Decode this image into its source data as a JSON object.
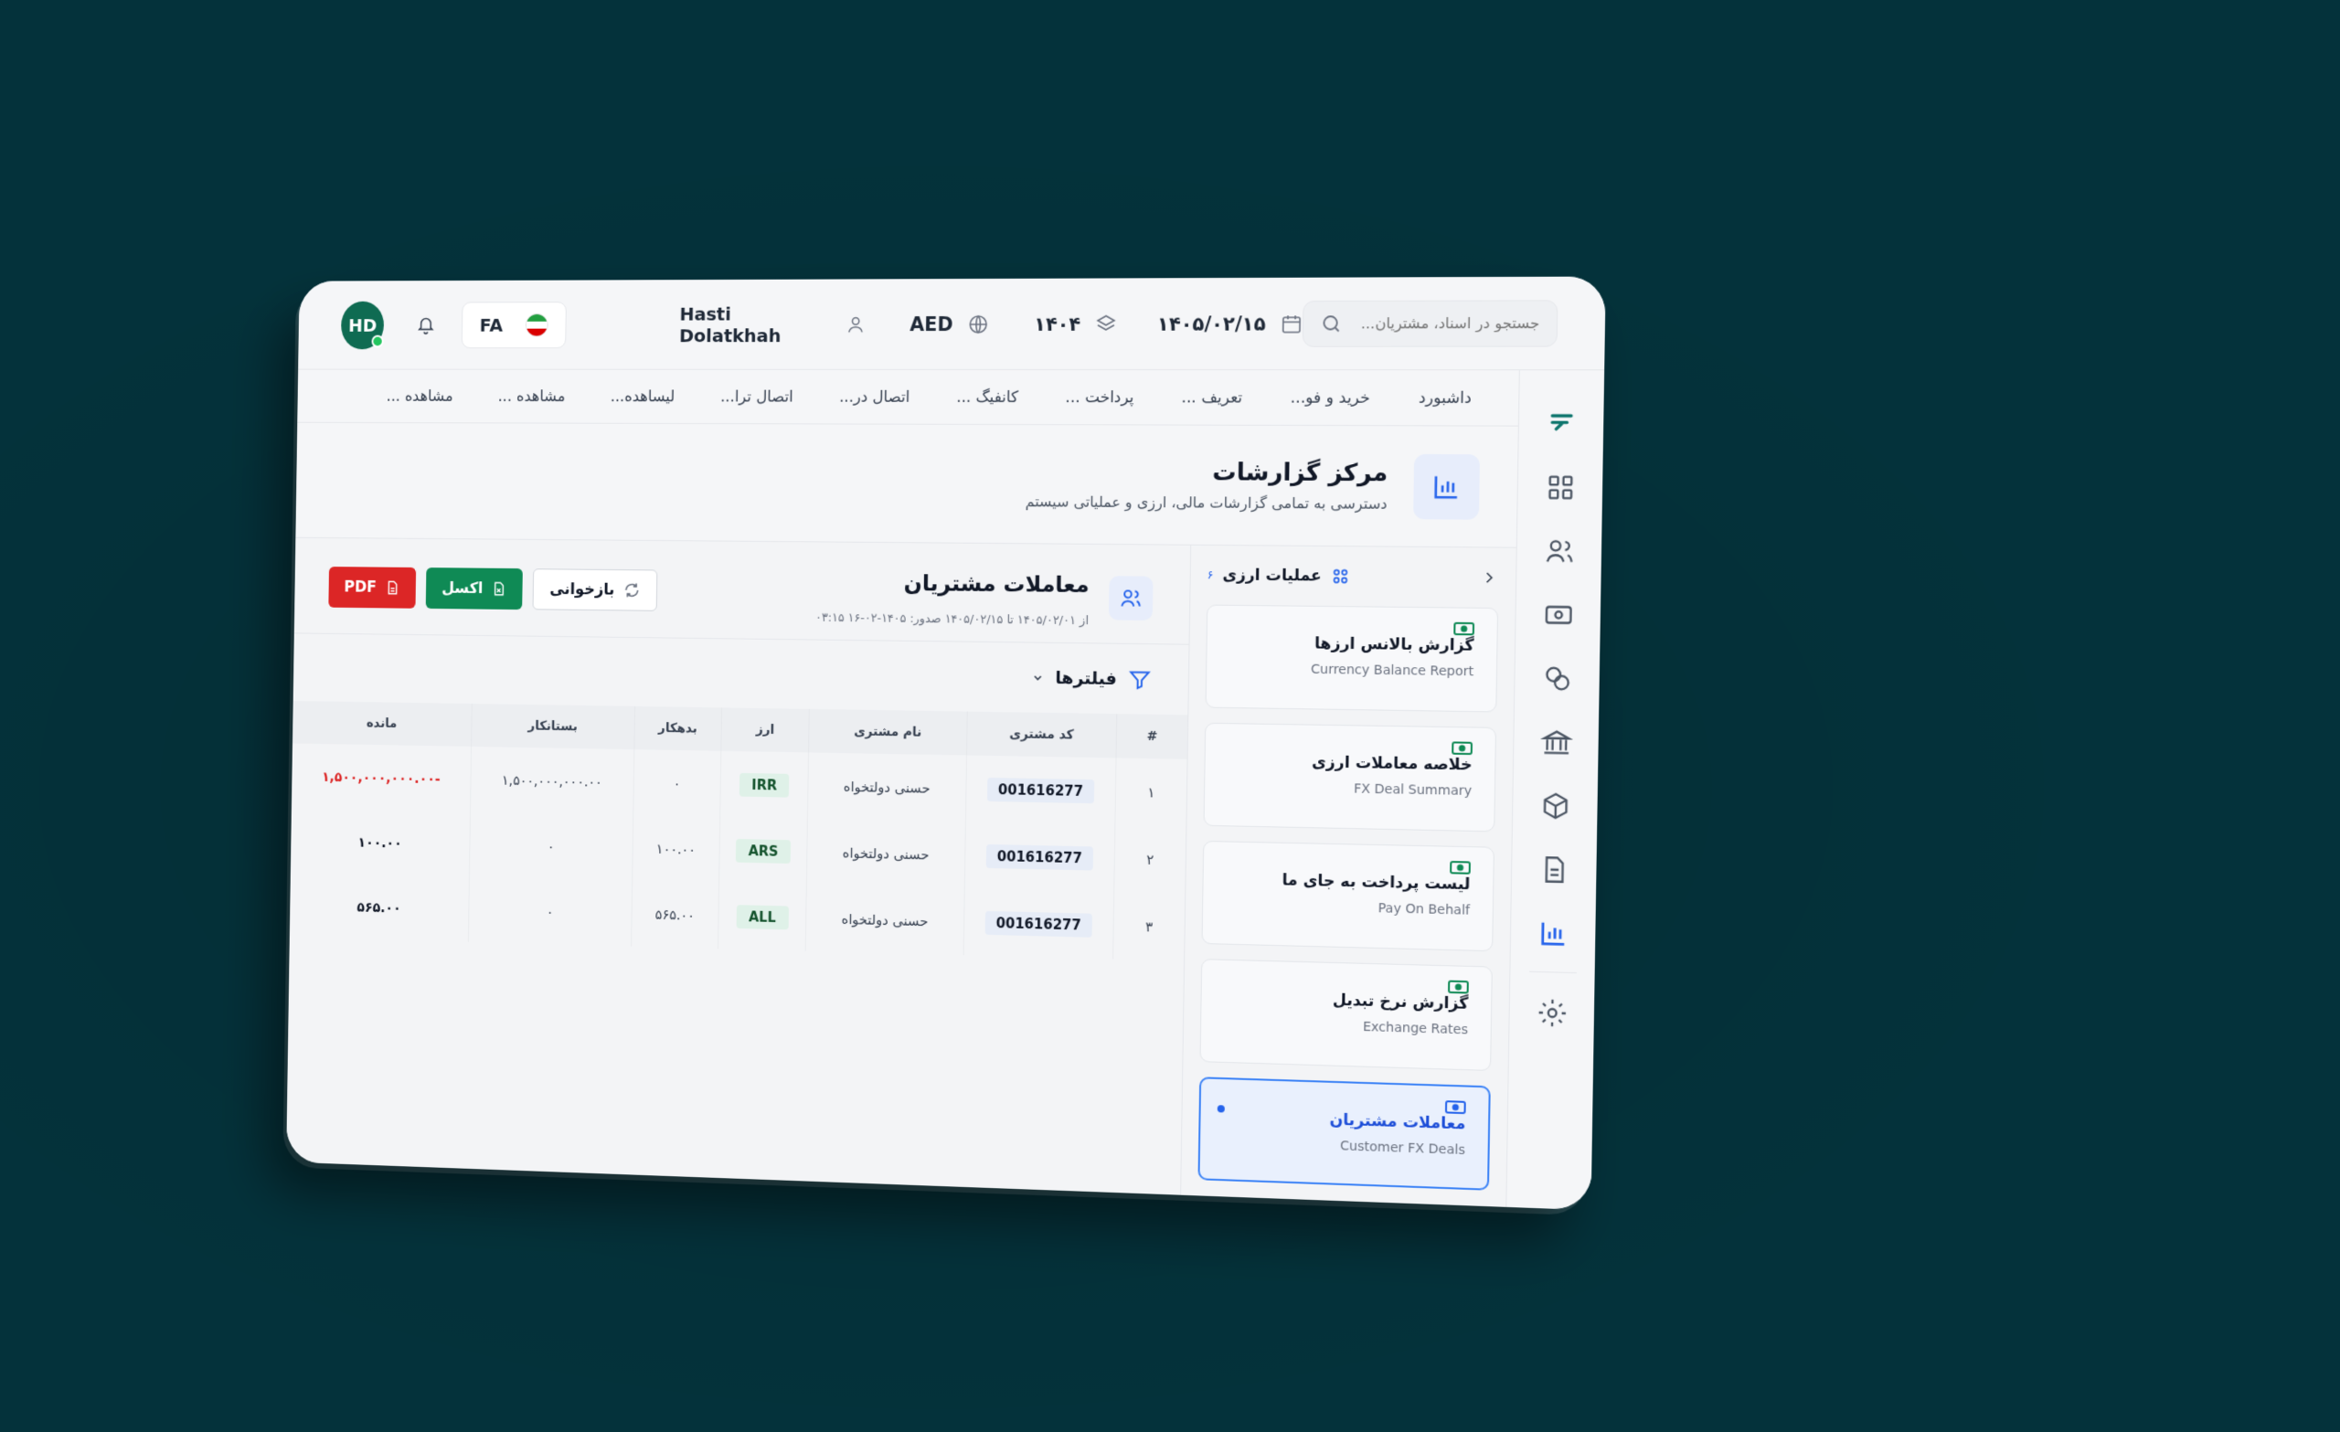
{
  "topbar": {
    "avatar_initials": "HD",
    "lang": "FA",
    "user_name": "Hasti Dolatkhah",
    "currency": "AED",
    "fiscal_year": "۱۴۰۴",
    "date": "۱۴۰۵/۰۲/۱۵",
    "search_placeholder": "جستجو در اسناد، مشتریان..."
  },
  "menu": [
    "داشبورد",
    "خرید و فو...",
    "تعریف ...",
    "پرداخت ...",
    "کانفیگ ...",
    "اتصال در...",
    "اتصال ترا...",
    "لیساهده...",
    "مشاهده ...",
    "مشاهده ..."
  ],
  "hero": {
    "title": "مرکز گزارشات",
    "subtitle": "دسترسی به تمامی گزارشات مالی، ارزی و عملیاتی سیستم"
  },
  "sidepanel": {
    "title": "عملیات ارزی",
    "count": "۶",
    "cards": [
      {
        "title": "گزارش بالانس ارزها",
        "subtitle": "Currency Balance Report"
      },
      {
        "title": "خلاصه معاملات ارزی",
        "subtitle": "FX Deal Summary"
      },
      {
        "title": "لیست پرداخت به جای ما",
        "subtitle": "Pay On Behalf"
      },
      {
        "title": "گزارش نرخ تبدیل",
        "subtitle": "Exchange Rates"
      },
      {
        "title": "معاملات مشتریان",
        "subtitle": "Customer FX Deals"
      }
    ]
  },
  "content": {
    "title": "معاملات مشتریان",
    "range": "از ۱۴۰۵/۰۲/۰۱ تا ۱۴۰۵/۰۲/۱۵  صدور: ۱۴۰۵-۰۲-۱۶ ۰۳:۱۵",
    "btn_refresh": "بازخوانی",
    "btn_excel": "اکسل",
    "btn_pdf": "PDF",
    "filters": "فیلترها"
  },
  "table": {
    "headers": [
      "#",
      "کد مشتری",
      "نام مشتری",
      "ارز",
      "بدهکار",
      "بستانکار",
      "مانده"
    ],
    "rows": [
      {
        "idx": "۱",
        "code": "001616277",
        "name": "حسنی دولتخواه",
        "cur": "IRR",
        "debit": "۰",
        "credit": "۱,۵۰۰,۰۰۰,۰۰۰.۰۰",
        "balance": "-۱,۵۰۰,۰۰۰,۰۰۰.۰۰"
      },
      {
        "idx": "۲",
        "code": "001616277",
        "name": "حسنی دولتخواه",
        "cur": "ARS",
        "debit": "۱۰۰.۰۰",
        "credit": "۰",
        "balance": "۱۰۰.۰۰"
      },
      {
        "idx": "۳",
        "code": "001616277",
        "name": "حسنی دولتخواه",
        "cur": "ALL",
        "debit": "۵۶۵.۰۰",
        "credit": "۰",
        "balance": "۵۶۵.۰۰"
      }
    ]
  },
  "colors": {
    "accent": "#2563eb",
    "pdf": "#dc2626",
    "excel": "#0f8a55",
    "avatar": "#0f6b52",
    "background": "#04323b"
  }
}
